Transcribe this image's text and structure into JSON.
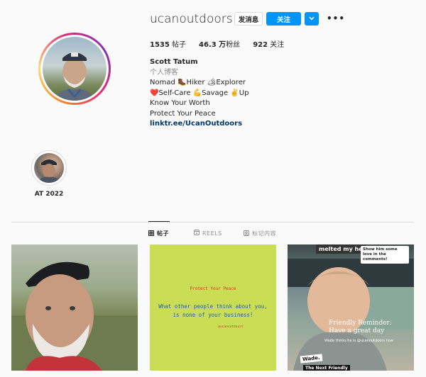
{
  "profile": {
    "username": "ucanoutdoors",
    "message_label": "发消息",
    "follow_label": "关注",
    "more_icon": "more-horizontal-icon"
  },
  "stats": {
    "posts_count": "1535",
    "posts_label": "帖子",
    "followers_count": "46.3 万",
    "followers_label": "粉丝",
    "following_count": "922",
    "following_label": "关注"
  },
  "bio": {
    "name": "Scott Tatum",
    "category": "个人博客",
    "line1": "Nomad 🥾Hiker 🏕Explorer",
    "line2": "❤️Self-Care 💪Savage ✌️Up",
    "line3": "Know Your Worth",
    "line4": "Protect Your Peace",
    "link": "linktr.ee/UcanOutdoors"
  },
  "highlights": [
    {
      "label": "AT 2022"
    }
  ],
  "tabs": [
    {
      "label": "帖子",
      "icon": "grid-icon",
      "active": true
    },
    {
      "label": "REELS",
      "icon": "reels-icon",
      "active": false
    },
    {
      "label": "标记内容",
      "icon": "tagged-icon",
      "active": false
    }
  ],
  "posts": [
    {
      "kind": "photo"
    },
    {
      "kind": "quote",
      "title": "Protect Your Peace",
      "quote_line1": "What other people think about you,",
      "quote_line2": "is none of your business!",
      "handle": "@ucanoutdoors"
    },
    {
      "kind": "photo",
      "top_text": "melted my he",
      "chip_text": "Show him some love in the comments!",
      "overlay1": "Friendly Reminder:",
      "overlay2": "Have a great day",
      "overlay3": "Wade thinks he is @ucanoutdoors now",
      "tag1": "Wade.",
      "tag2": "The Next Friendly"
    }
  ],
  "colors": {
    "accent": "#0095f6",
    "link": "#00376b",
    "quote_bg": "#c9dd55"
  }
}
